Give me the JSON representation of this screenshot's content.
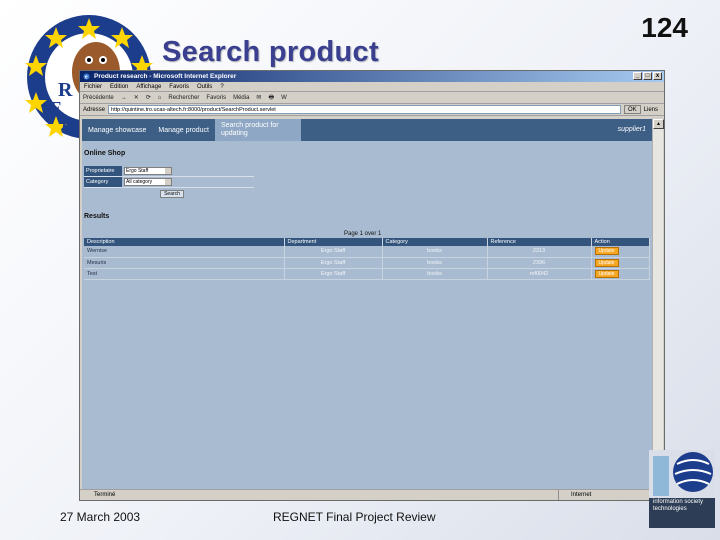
{
  "slide": {
    "title": "Search product",
    "number": "124",
    "footer_date": "27 March 2003",
    "footer_center": "REGNET Final Project Review"
  },
  "ist_logo_text": "information society technologies",
  "browser": {
    "window_title": "Product research - Microsoft Internet Explorer",
    "window_buttons": [
      "_",
      "□",
      "x"
    ],
    "menu": [
      "Fichier",
      "Edition",
      "Affichage",
      "Favoris",
      "Outils",
      "?"
    ],
    "toolbar": [
      "Précédente",
      "→",
      "✕",
      "⟳",
      "⌂",
      "Rechercher",
      "Favoris",
      "Média",
      "✉",
      "🖶",
      "W"
    ],
    "address_label": "Adresse",
    "address_url": "http://quintine.tro.ucas-altech.fr:8000/product/SearchProduct.servlet",
    "go_label": "OK",
    "links_label": "Liens",
    "status_left": "Terminé",
    "status_zone": "Internet"
  },
  "app": {
    "nav": [
      "Manage showcase",
      "Manage product"
    ],
    "nav_active": "Search product for updating",
    "user": "supplier1",
    "shop_title": "Online Shop",
    "form": {
      "rows": [
        {
          "label": "Proprietaire",
          "value": "Ergo Staff"
        },
        {
          "label": "Category",
          "value": "All category"
        }
      ],
      "search_label": "Search"
    },
    "results_title": "Results",
    "page_info": "Page 1 over 1",
    "table": {
      "headers": [
        "Description",
        "Department",
        "Category",
        "Reference",
        "Action"
      ],
      "rows": [
        {
          "desc": "Wernise",
          "dept": "Ergo Staff",
          "cat": "books",
          "ref": "2313",
          "action": "Update"
        },
        {
          "desc": "Mesuris",
          "dept": "Ergo Staff",
          "cat": "books",
          "ref": "2396",
          "action": "Update"
        },
        {
          "desc": "Test",
          "dept": "Ergo Staff",
          "cat": "books",
          "ref": "ref0042",
          "action": "Update"
        }
      ]
    }
  },
  "colors": {
    "title": "#3a3f8f",
    "nav_bar": "#3d5f86",
    "content_bg": "#a9bbd0",
    "header_bg": "#33557d",
    "action_button": "#f5a623",
    "eu_blue": "#1c3c8c",
    "eu_star": "#ffd500"
  }
}
